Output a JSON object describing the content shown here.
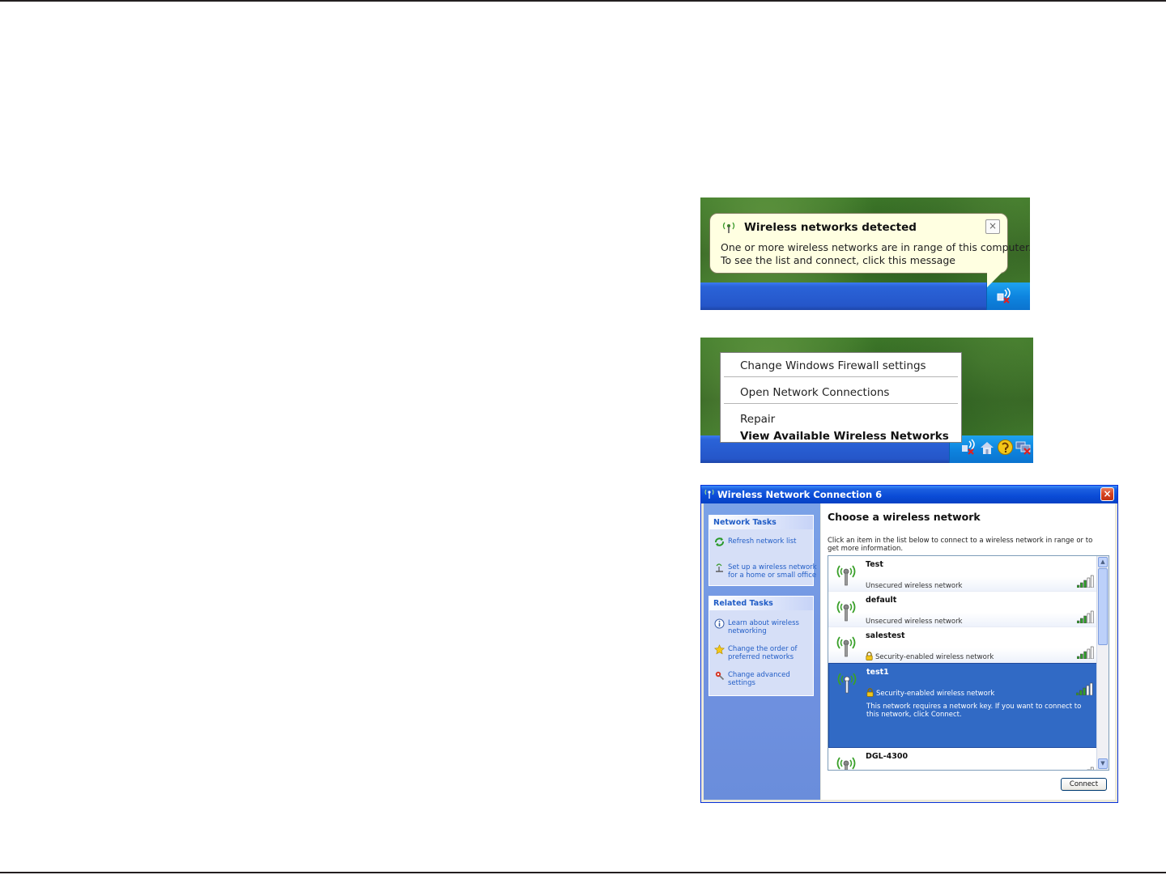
{
  "balloon": {
    "title": "Wireless networks detected",
    "line1": "One or more wireless networks are in range of this computer.",
    "line2": "To see the list and connect, click this message",
    "close": "×"
  },
  "context_menu": {
    "items": [
      "Change Windows Firewall settings",
      "Open Network Connections",
      "Repair",
      "View Available Wireless Networks"
    ]
  },
  "window": {
    "title": "Wireless Network Connection 6",
    "close": "×",
    "network_tasks": {
      "heading": "Network Tasks",
      "links": [
        {
          "line1": "Refresh network list",
          "line2": ""
        },
        {
          "line1": "Set up a wireless network",
          "line2": "for a home or small office"
        }
      ]
    },
    "related_tasks": {
      "heading": "Related Tasks",
      "links": [
        {
          "line1": "Learn about wireless",
          "line2": "networking"
        },
        {
          "line1": "Change the order of",
          "line2": "preferred networks"
        },
        {
          "line1": "Change advanced",
          "line2": "settings"
        }
      ]
    },
    "main_title": "Choose a wireless network",
    "description": "Click an item in the list below to connect to a wireless network in range or to get more information.",
    "networks": [
      {
        "name": "Test",
        "status": "Unsecured wireless network",
        "secure": false,
        "signal": 0.8
      },
      {
        "name": "default",
        "status": "Unsecured wireless network",
        "secure": false,
        "signal": 0.8
      },
      {
        "name": "salestest",
        "status": "Security-enabled wireless network",
        "secure": true,
        "signal": 0.8
      },
      {
        "name": "test1",
        "status": "Security-enabled wireless network",
        "secure": true,
        "signal": 0.8,
        "selected": true,
        "message": "This network requires a network key. If you want to connect to this network, click Connect."
      },
      {
        "name": "DGL-4300",
        "status": "",
        "secure": false,
        "signal": 0.8
      }
    ],
    "connect_label": "Connect"
  },
  "colors": {
    "selection": "#316ac5",
    "link": "#215dc6",
    "titlebar": "#0a4bd6",
    "balloon_bg": "#ffffe1"
  }
}
